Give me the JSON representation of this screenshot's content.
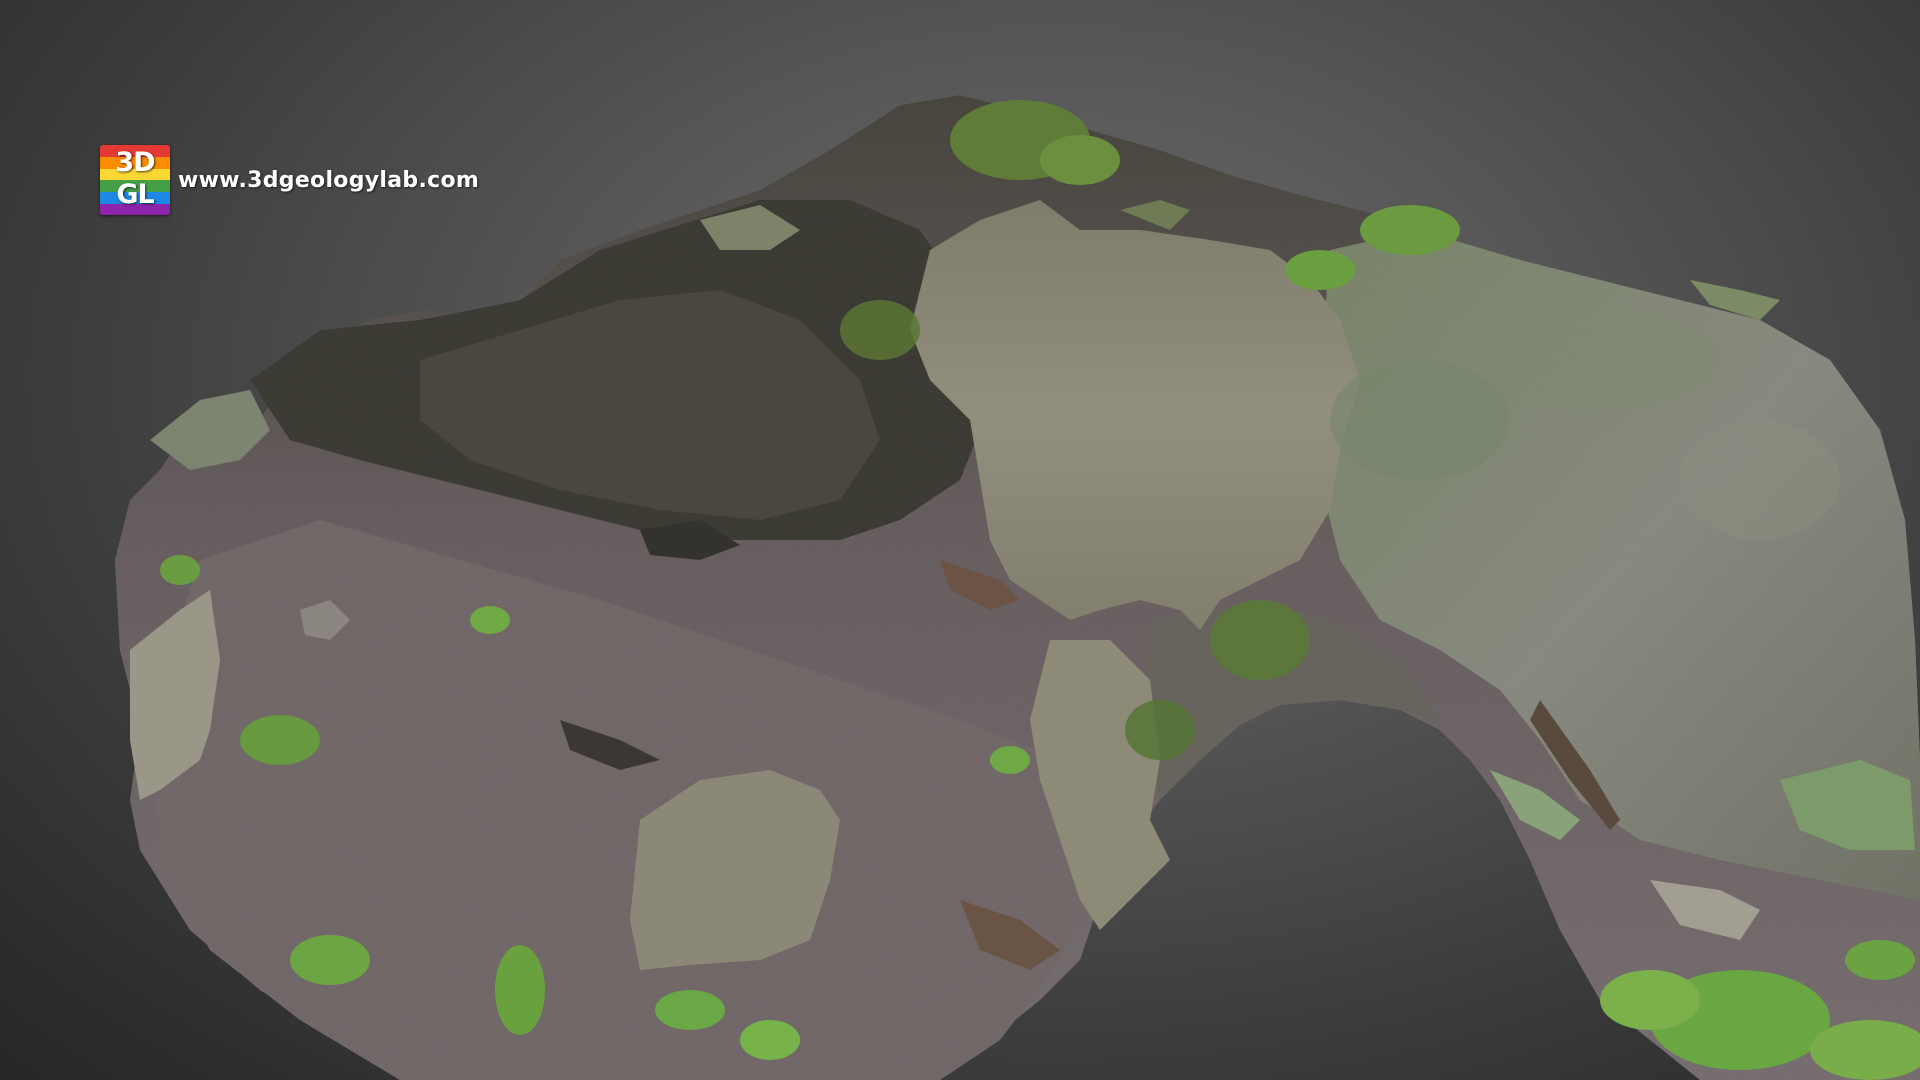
{
  "scene": {
    "background_colors": [
      "#6d6d6d",
      "#555555",
      "#3a3a3a",
      "#262626"
    ],
    "model_colors": {
      "soil": "#6f6566",
      "rock": "#8a8a7e",
      "moss": "#5c7a3e",
      "leaf": "#6fa640",
      "hole_fill": "#8d8a7a",
      "dark_rock": "#3c3a34"
    }
  },
  "watermark": {
    "logo_line1": "3D",
    "logo_line2": "GL",
    "logo_colors": [
      "#e53935",
      "#fb8c00",
      "#fdd835",
      "#43a047",
      "#1e88e5",
      "#8e24aa"
    ],
    "site_url": "www.3dgeologylab.com"
  }
}
